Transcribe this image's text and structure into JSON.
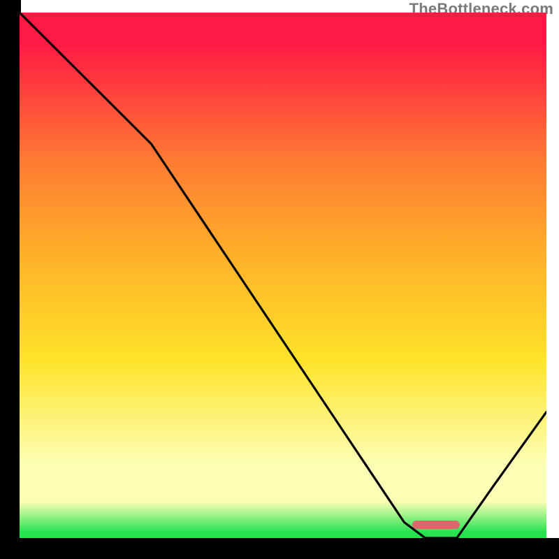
{
  "watermark": "TheBottleneck.com",
  "colors": {
    "red": "#ff1a45",
    "orange1": "#ff7a33",
    "orange2": "#ffb029",
    "yellow": "#ffe329",
    "paleyel": "#feffb6",
    "green": "#24e34f",
    "marker": "#d86a6e"
  },
  "marker": {
    "left_pct": 74.5,
    "top_pct": 96.7,
    "width_pct": 9.0,
    "height_pct": 1.6
  },
  "chart_data": {
    "type": "line",
    "title": "",
    "xlabel": "",
    "ylabel": "",
    "xlim": [
      0,
      100
    ],
    "ylim": [
      0,
      100
    ],
    "note": "x is normalized horizontal position (0=left axis, 100=right edge); y is the V-shaped bottleneck-mismatch curve value (100=top of plot, 0=bottom). The curve descends from top-left, kinks near x≈25, reaches ~0 around x≈75–83, then rises again. A marker bar highlights x≈75–84 at y≈0.",
    "series": [
      {
        "name": "bottleneck-curve",
        "x": [
          0,
          10,
          20,
          25,
          35,
          45,
          55,
          65,
          73,
          77,
          83,
          90,
          100
        ],
        "y": [
          100,
          90,
          80,
          75,
          60,
          45,
          30,
          15,
          3,
          0,
          0,
          10,
          24
        ]
      }
    ],
    "optimal_band_x": [
      74.5,
      83.5
    ]
  }
}
